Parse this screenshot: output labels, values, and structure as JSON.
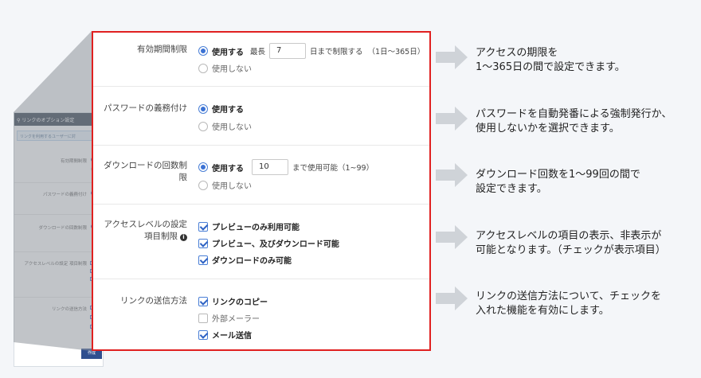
{
  "thumbnail": {
    "header_title": "リンクのオプション設定",
    "note": "リンクを利用するユーザーに対",
    "rows": [
      {
        "label": "有効期間制限"
      },
      {
        "label": "パスワードの義務付け"
      },
      {
        "label": "ダウンロードの回数制限"
      },
      {
        "label": "アクセスレベルの設定 項目制限"
      },
      {
        "label": "リンクの送信方法"
      }
    ],
    "button_label": "作成"
  },
  "panel": {
    "expiry": {
      "label": "有効期間制限",
      "use_label": "使用する",
      "max_label": "最長",
      "days_value": "7",
      "suffix": "日まで制限する",
      "range_hint": "（1日～365日）",
      "no_use_label": "使用しない",
      "selected": "use"
    },
    "password": {
      "label": "パスワードの義務付け",
      "use_label": "使用する",
      "no_use_label": "使用しない",
      "selected": "use"
    },
    "download": {
      "label_line1": "ダウンロードの回数制",
      "label_line2": "限",
      "use_label": "使用する",
      "count_value": "10",
      "suffix": "まで使用可能（1~99）",
      "no_use_label": "使用しない",
      "selected": "use"
    },
    "access": {
      "label_line1": "アクセスレベルの設定",
      "label_line2": "項目制限",
      "info_icon": "info-icon",
      "options": [
        {
          "label": "プレビューのみ利用可能",
          "checked": true
        },
        {
          "label": "プレビュー、及びダウンロード可能",
          "checked": true
        },
        {
          "label": "ダウンロードのみ可能",
          "checked": true
        }
      ]
    },
    "send": {
      "label": "リンクの送信方法",
      "options": [
        {
          "label": "リンクのコピー",
          "checked": true
        },
        {
          "label": "外部メーラー",
          "checked": false
        },
        {
          "label": "メール送信",
          "checked": true
        }
      ]
    }
  },
  "descriptions": [
    {
      "line1": "アクセスの期限を",
      "line2": "1～365日の間で設定できます。"
    },
    {
      "line1": "パスワードを自動発番による強制発行か、",
      "line2": "使用しないかを選択できます。"
    },
    {
      "line1": "ダウンロード回数を1～99回の間で",
      "line2": "設定できます。"
    },
    {
      "line1": "アクセスレベルの項目の表示、非表示が",
      "line2": "可能となります。（チェックが表示項目）"
    },
    {
      "line1": "リンクの送信方法について、チェックを",
      "line2": "入れた機能を有効にします。"
    }
  ],
  "colors": {
    "highlight_border": "#e02020",
    "accent": "#3b72d4",
    "arrow": "#cfd3d8"
  }
}
